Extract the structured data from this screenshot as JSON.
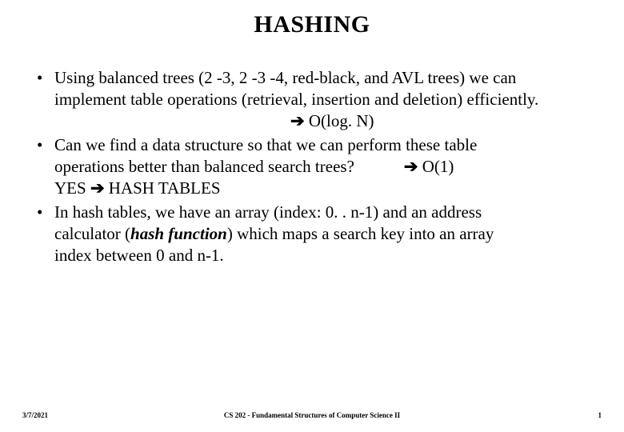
{
  "title": "HASHING",
  "bullets": {
    "b1": {
      "line1": "Using balanced trees (2 -3, 2 -3 -4, red-black, and AVL trees) we can",
      "line2": "implement table operations (retrieval, insertion and deletion) efficiently.",
      "complexity_arrow": "➔",
      "complexity": " O(log. N)"
    },
    "b2": {
      "line1": "Can we find a data structure so that we can perform these table",
      "line2a": "operations better than balanced search trees?",
      "line2_arrow": "➔",
      "line2b": " O(1)",
      "yes": "YES ",
      "yes_arrow": "➔",
      "yes_after": " HASH TABLES"
    },
    "b3": {
      "line1": "In hash tables, we have an array (index: 0. . n-1) and an address",
      "line2a": "calculator (",
      "line2_ital": "hash function",
      "line2b": ") which maps a search key into an array",
      "line3": "index between 0 and n-1."
    }
  },
  "footer": {
    "date": "3/7/2021",
    "course": "CS 202 - Fundamental Structures of Computer Science II",
    "page": "1"
  }
}
